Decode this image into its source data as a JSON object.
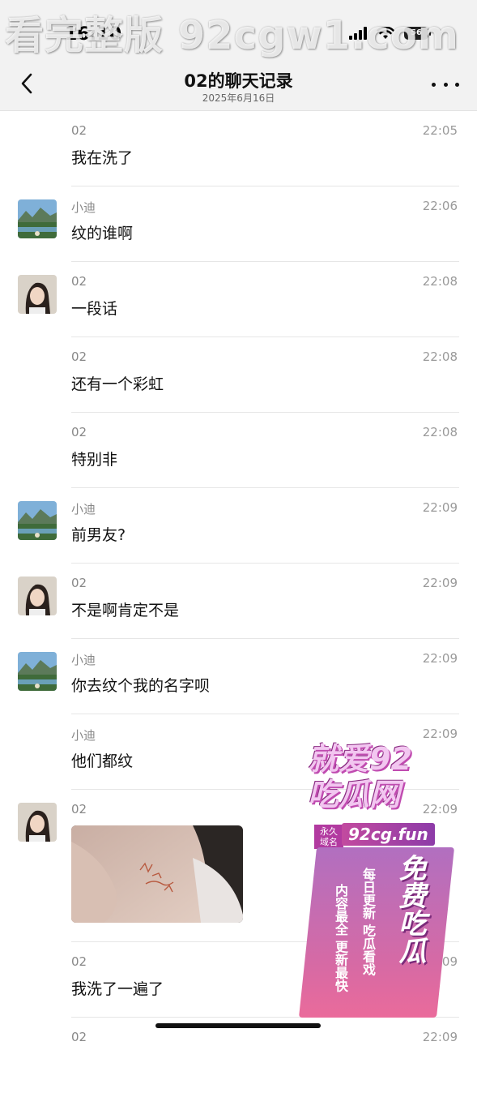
{
  "status_bar": {
    "time": "16:10",
    "battery_level": "56"
  },
  "watermark": "看完整版 92cgw1.com",
  "nav": {
    "back_icon": "chevron-left-icon",
    "title": "02的聊天记录",
    "subtitle": "2025年6月16日",
    "more_icon": "more-horizontal-icon"
  },
  "messages": [
    {
      "sender": "02",
      "time": "22:05",
      "text": "我在洗了",
      "avatar": "none"
    },
    {
      "sender": "小迪",
      "time": "22:06",
      "text": "纹的谁啊",
      "avatar": "landscape"
    },
    {
      "sender": "02",
      "time": "22:08",
      "text": "一段话",
      "avatar": "woman"
    },
    {
      "sender": "02",
      "time": "22:08",
      "text": "还有一个彩虹",
      "avatar": "none"
    },
    {
      "sender": "02",
      "time": "22:08",
      "text": "特别非",
      "avatar": "none"
    },
    {
      "sender": "小迪",
      "time": "22:09",
      "text": "前男友?",
      "avatar": "landscape"
    },
    {
      "sender": "02",
      "time": "22:09",
      "text": "不是啊肯定不是",
      "avatar": "woman"
    },
    {
      "sender": "小迪",
      "time": "22:09",
      "text": "你去纹个我的名字呗",
      "avatar": "landscape"
    },
    {
      "sender": "小迪",
      "time": "22:09",
      "text": "他们都纹",
      "avatar": "none"
    },
    {
      "sender": "02",
      "time": "22:09",
      "text": "",
      "avatar": "woman",
      "image": "tattoo-photo"
    },
    {
      "sender": "02",
      "time": "22:09",
      "text": "我洗了一遍了",
      "avatar": "none"
    },
    {
      "sender": "02",
      "time": "22:09",
      "text": "",
      "avatar": "none"
    }
  ],
  "ad": {
    "line1": "就爱92",
    "line2": "吃瓜网",
    "badge": "永久域名",
    "domain": "92cg.fun",
    "free": "免费吃瓜",
    "daily": "每日更新 吃瓜看戏",
    "content": "内容最全 更新最快"
  }
}
